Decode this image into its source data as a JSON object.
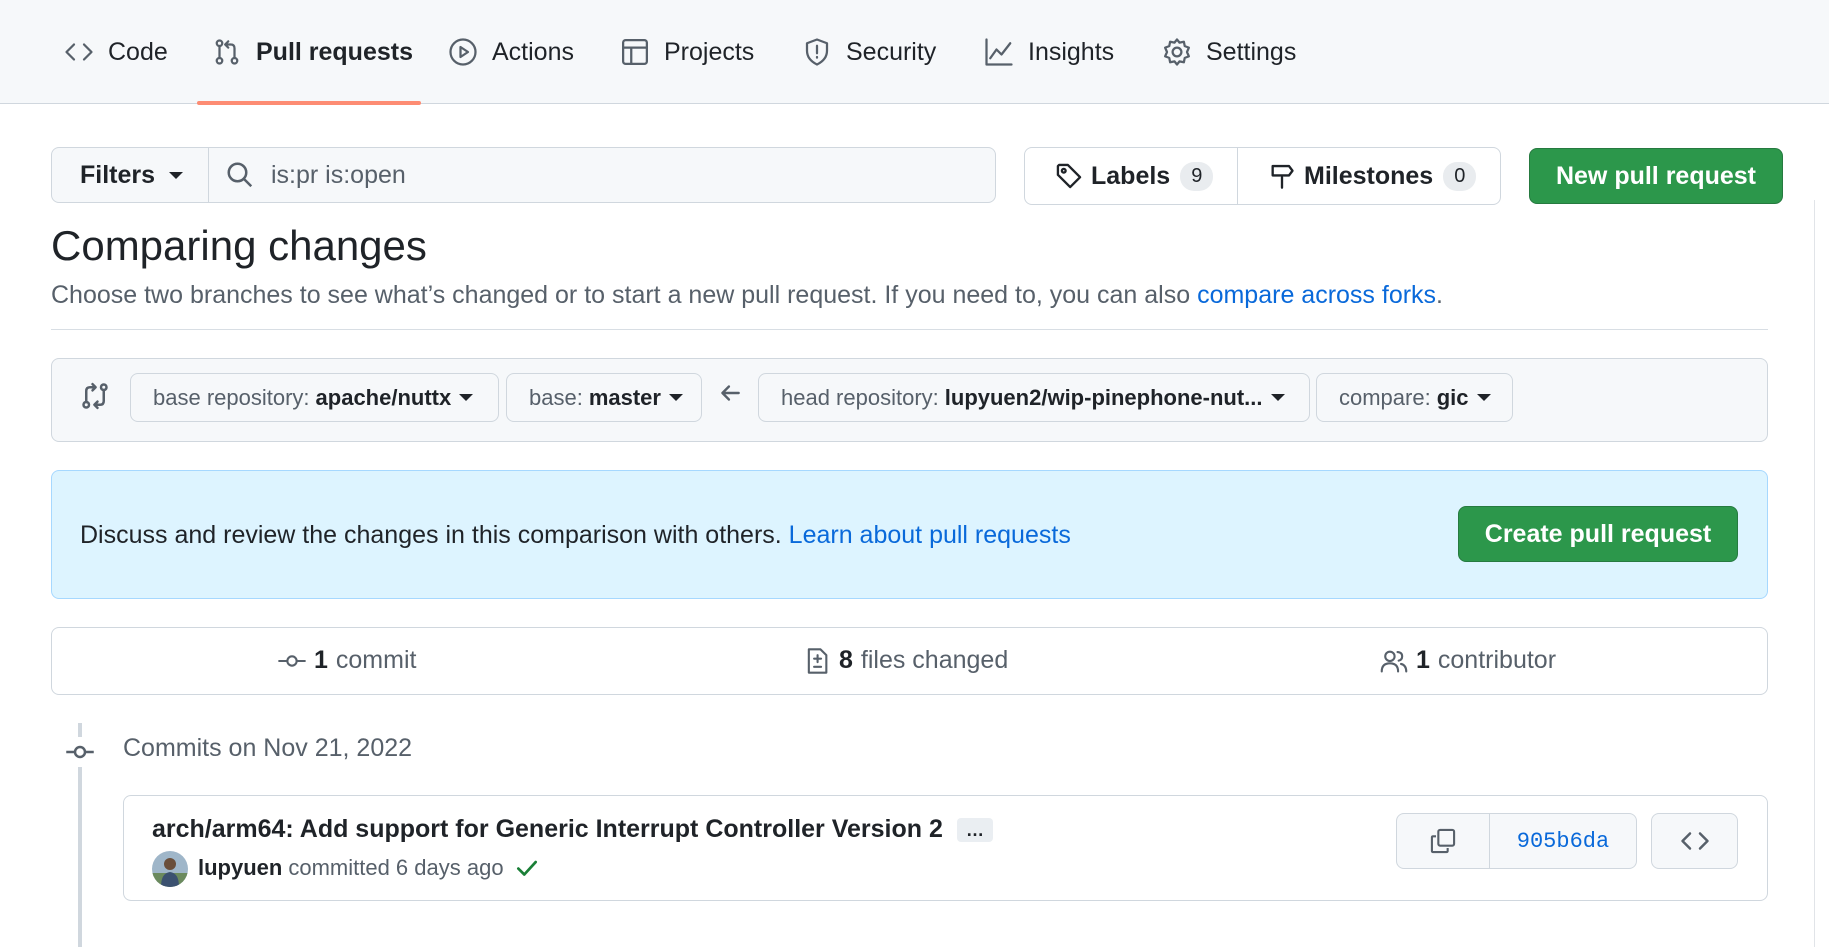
{
  "repo_nav": {
    "tabs": [
      {
        "label": "Code",
        "icon": "code-icon"
      },
      {
        "label": "Pull requests",
        "icon": "git-pull-request-icon",
        "active": true
      },
      {
        "label": "Actions",
        "icon": "play-icon"
      },
      {
        "label": "Projects",
        "icon": "table-icon"
      },
      {
        "label": "Security",
        "icon": "shield-icon"
      },
      {
        "label": "Insights",
        "icon": "graph-icon"
      },
      {
        "label": "Settings",
        "icon": "gear-icon"
      }
    ],
    "active_underline_color": "#fd8c73"
  },
  "toolbar": {
    "filters_label": "Filters",
    "search_value": "is:pr is:open",
    "labels_label": "Labels",
    "labels_count": "9",
    "milestones_label": "Milestones",
    "milestones_count": "0",
    "new_pr_label": "New pull request"
  },
  "compare": {
    "title": "Comparing changes",
    "subtitle_text": "Choose two branches to see what’s changed or to start a new pull request. If you need to, you can also ",
    "subtitle_link": "compare across forks",
    "subtitle_end": ".",
    "base_repo_label": "base repository:",
    "base_repo_value": "apache/nuttx",
    "base_label": "base:",
    "base_value": "master",
    "head_repo_label": "head repository:",
    "head_repo_value": "lupyuen2/wip-pinephone-nut...",
    "compare_label": "compare:",
    "compare_value": "gic"
  },
  "flash": {
    "text": "Discuss and review the changes in this comparison with others. ",
    "link": "Learn about pull requests",
    "button": "Create pull request"
  },
  "stats": {
    "commits_count": "1",
    "commits_label": "commit",
    "files_count": "8",
    "files_label": "files changed",
    "contributors_count": "1",
    "contributors_label": "contributor"
  },
  "commits": {
    "date_heading": "Commits on Nov 21, 2022",
    "items": [
      {
        "title": "arch/arm64: Add support for Generic Interrupt Controller Version 2",
        "ellipsis": "…",
        "author": "lupyuen",
        "action": "committed 6 days ago",
        "sha": "905b6da"
      }
    ]
  },
  "colors": {
    "primary_green": "#2c974b",
    "link_blue": "#0969da",
    "flash_bg": "#ddf4ff"
  }
}
